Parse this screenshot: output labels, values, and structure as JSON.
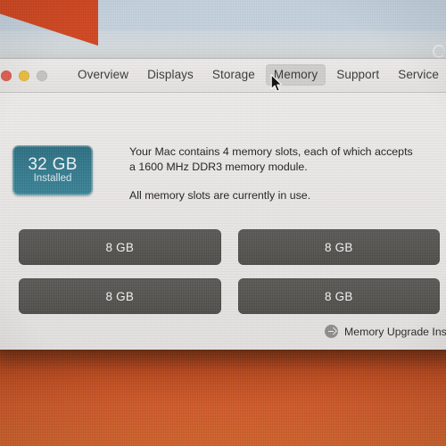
{
  "window": {
    "traffic_lights": [
      {
        "name": "close",
        "color": "#dd5f52"
      },
      {
        "name": "minimize",
        "color": "#e8bc3d"
      },
      {
        "name": "zoom",
        "color": "#c3c3c1"
      }
    ],
    "tabs": [
      {
        "label": "Overview",
        "active": false
      },
      {
        "label": "Displays",
        "active": false
      },
      {
        "label": "Storage",
        "active": false
      },
      {
        "label": "Memory",
        "active": true
      },
      {
        "label": "Support",
        "active": false
      },
      {
        "label": "Service",
        "active": false
      }
    ]
  },
  "memory": {
    "badge": {
      "capacity": "32 GB",
      "status": "Installed",
      "color": "#35788b"
    },
    "description_line1": "Your Mac contains 4 memory slots, each of which accepts",
    "description_line2": "a 1600 MHz DDR3 memory module.",
    "description_line3": "All memory slots are currently in use.",
    "slots": [
      {
        "size": "8 GB"
      },
      {
        "size": "8 GB"
      },
      {
        "size": "8 GB"
      },
      {
        "size": "8 GB"
      }
    ],
    "footer_link": "Memory Upgrade Ins"
  },
  "desktop": {
    "wallpaper_colors": {
      "teal": "#3b7f99",
      "light_blue": "#c3d0dc",
      "pale_gray": "#d8dcdd",
      "orange": "#cf4722",
      "bottom_orange": "#cd5a2b"
    }
  }
}
